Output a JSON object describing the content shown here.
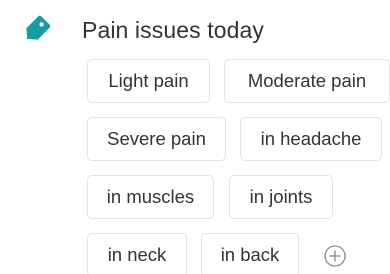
{
  "title": "Pain issues today",
  "icons": {
    "category": "tag-icon",
    "add": "plus-circle-icon"
  },
  "colors": {
    "accent": "#159ca4"
  },
  "chips": [
    {
      "label": "Light pain"
    },
    {
      "label": "Moderate pain"
    },
    {
      "label": "Severe pain"
    },
    {
      "label": "in headache"
    },
    {
      "label": "in muscles"
    },
    {
      "label": "in joints"
    },
    {
      "label": "in neck"
    },
    {
      "label": "in back"
    }
  ]
}
